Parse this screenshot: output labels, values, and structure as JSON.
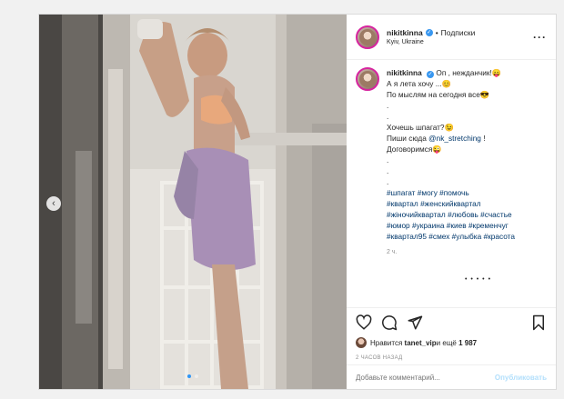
{
  "post": {
    "header": {
      "username": "nikitkinna",
      "separator": "•",
      "follow_label": "Подписки",
      "location": "Kyiv, Ukraine",
      "more_icon": "more-icon"
    },
    "caption": {
      "username": "nikitkinna",
      "lines": [
        "Оп , нежданчик!😛",
        "А я лета хочу ...😊",
        "По мыслям на сегодня все😎",
        ".",
        ".",
        "Хочешь шпагат?😉",
        "Пиши сюда ",
        "Договоримся😜",
        ".",
        ".",
        "."
      ],
      "mention": "@nk_stretching",
      "mention_suffix": " !",
      "hashtag_lines": [
        "#шпагат #могу #помочь",
        "#квартал #женскийквартал",
        "#жіночийквартал #любовь #счастье",
        "#юмор #украина #киев #кременчуг",
        "#квартал95 #смех #улыбка #красота"
      ],
      "time": "2 ч.",
      "partial_comment": "• • • • •"
    },
    "likes": {
      "prefix": "Нравится ",
      "user": "tanet_vip",
      "middle": " и ещё ",
      "count": "1 987"
    },
    "posted_ago": "2 ЧАСОВ НАЗАД",
    "comment": {
      "placeholder": "Добавьте комментарий...",
      "publish_label": "Опубликовать"
    },
    "photo": {
      "prev_arrow": "‹"
    }
  },
  "colors": {
    "accent": "#3897f0",
    "link": "#00376b",
    "muted": "#8e8e8e",
    "publish_disabled": "#b2dffc"
  }
}
